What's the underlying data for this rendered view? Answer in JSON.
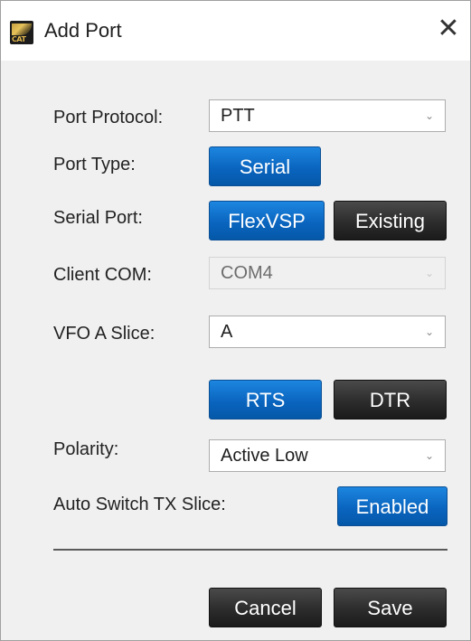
{
  "window": {
    "title": "Add Port",
    "close_symbol": "✕",
    "icon_text": "CAT"
  },
  "form": {
    "port_protocol": {
      "label": "Port Protocol:",
      "value": "PTT"
    },
    "port_type": {
      "label": "Port Type:",
      "button": "Serial"
    },
    "serial_port": {
      "label": "Serial Port:",
      "flexvsp": "FlexVSP",
      "existing": "Existing"
    },
    "client_com": {
      "label": "Client COM:",
      "value": "COM4"
    },
    "vfo_a_slice": {
      "label": "VFO A Slice:",
      "value": "A"
    },
    "lines": {
      "rts": "RTS",
      "dtr": "DTR"
    },
    "polarity": {
      "label": "Polarity:",
      "value": "Active Low"
    },
    "auto_switch": {
      "label": "Auto Switch TX Slice:",
      "button": "Enabled"
    }
  },
  "footer": {
    "cancel": "Cancel",
    "save": "Save"
  },
  "icons": {
    "dropdown": "chevron-down-icon",
    "close": "close-icon",
    "app": "cat-app-icon"
  },
  "colors": {
    "accent_blue": "#0a65bf",
    "dark_button": "#2c2c2c",
    "background": "#f0f0f0"
  }
}
